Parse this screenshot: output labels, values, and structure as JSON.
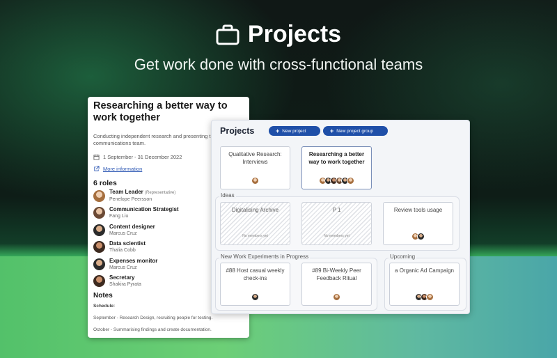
{
  "hero": {
    "title": "Projects",
    "subtitle": "Get work done with cross-functional teams",
    "icon": "briefcase-icon"
  },
  "colors": {
    "accent": "#1f4fa8",
    "link": "#2b56b3",
    "background_green": "#5cc46c"
  },
  "detail": {
    "title": "Researching a better way to work together",
    "description": "Conducting independent research and presenting t the communications team.",
    "date_range": "1 September - 31 December 2022",
    "more_info": "More information",
    "roles_title": "6 roles",
    "roles": [
      {
        "role": "Team Leader",
        "note": "(Representative)",
        "person": "Penelope Peersson"
      },
      {
        "role": "Communication Strategist",
        "note": "",
        "person": "Fang Liu"
      },
      {
        "role": "Content designer",
        "note": "",
        "person": "Marcus Cruz"
      },
      {
        "role": "Data scientist",
        "note": "",
        "person": "Thalia Cobb"
      },
      {
        "role": "Expenses monitor",
        "note": "",
        "person": "Marcus Cruz"
      },
      {
        "role": "Secretary",
        "note": "",
        "person": "Shakira Pyrata"
      }
    ],
    "notes_title": "Notes",
    "notes_schedule": "Schedule:",
    "notes": [
      "September - Research Design, recruiting people for testing.",
      "October - Summarising findings and create documentation."
    ]
  },
  "board": {
    "title": "Projects",
    "new_project": "New project",
    "new_group": "New project group",
    "top_cards": [
      {
        "title": "Qualitative Research: Interviews"
      },
      {
        "title": "Researching a better way to work together"
      }
    ],
    "groups": {
      "ideas": {
        "label": "Ideas",
        "cards": [
          {
            "title": "Digitalising Archive",
            "empty": "No members yet"
          },
          {
            "title": "P 1",
            "empty": "No members yet"
          },
          {
            "title": "Review tools usage"
          }
        ]
      },
      "in_progress": {
        "label": "New Work Experiments in Progress",
        "cards": [
          {
            "title": "#88 Host casual weekly check-ins"
          },
          {
            "title": "#89 Bi-Weekly Peer Feedback Ritual"
          }
        ]
      },
      "upcoming": {
        "label": "Upcoming",
        "cards": [
          {
            "title": "a Organic Ad Campaign"
          }
        ]
      }
    }
  }
}
